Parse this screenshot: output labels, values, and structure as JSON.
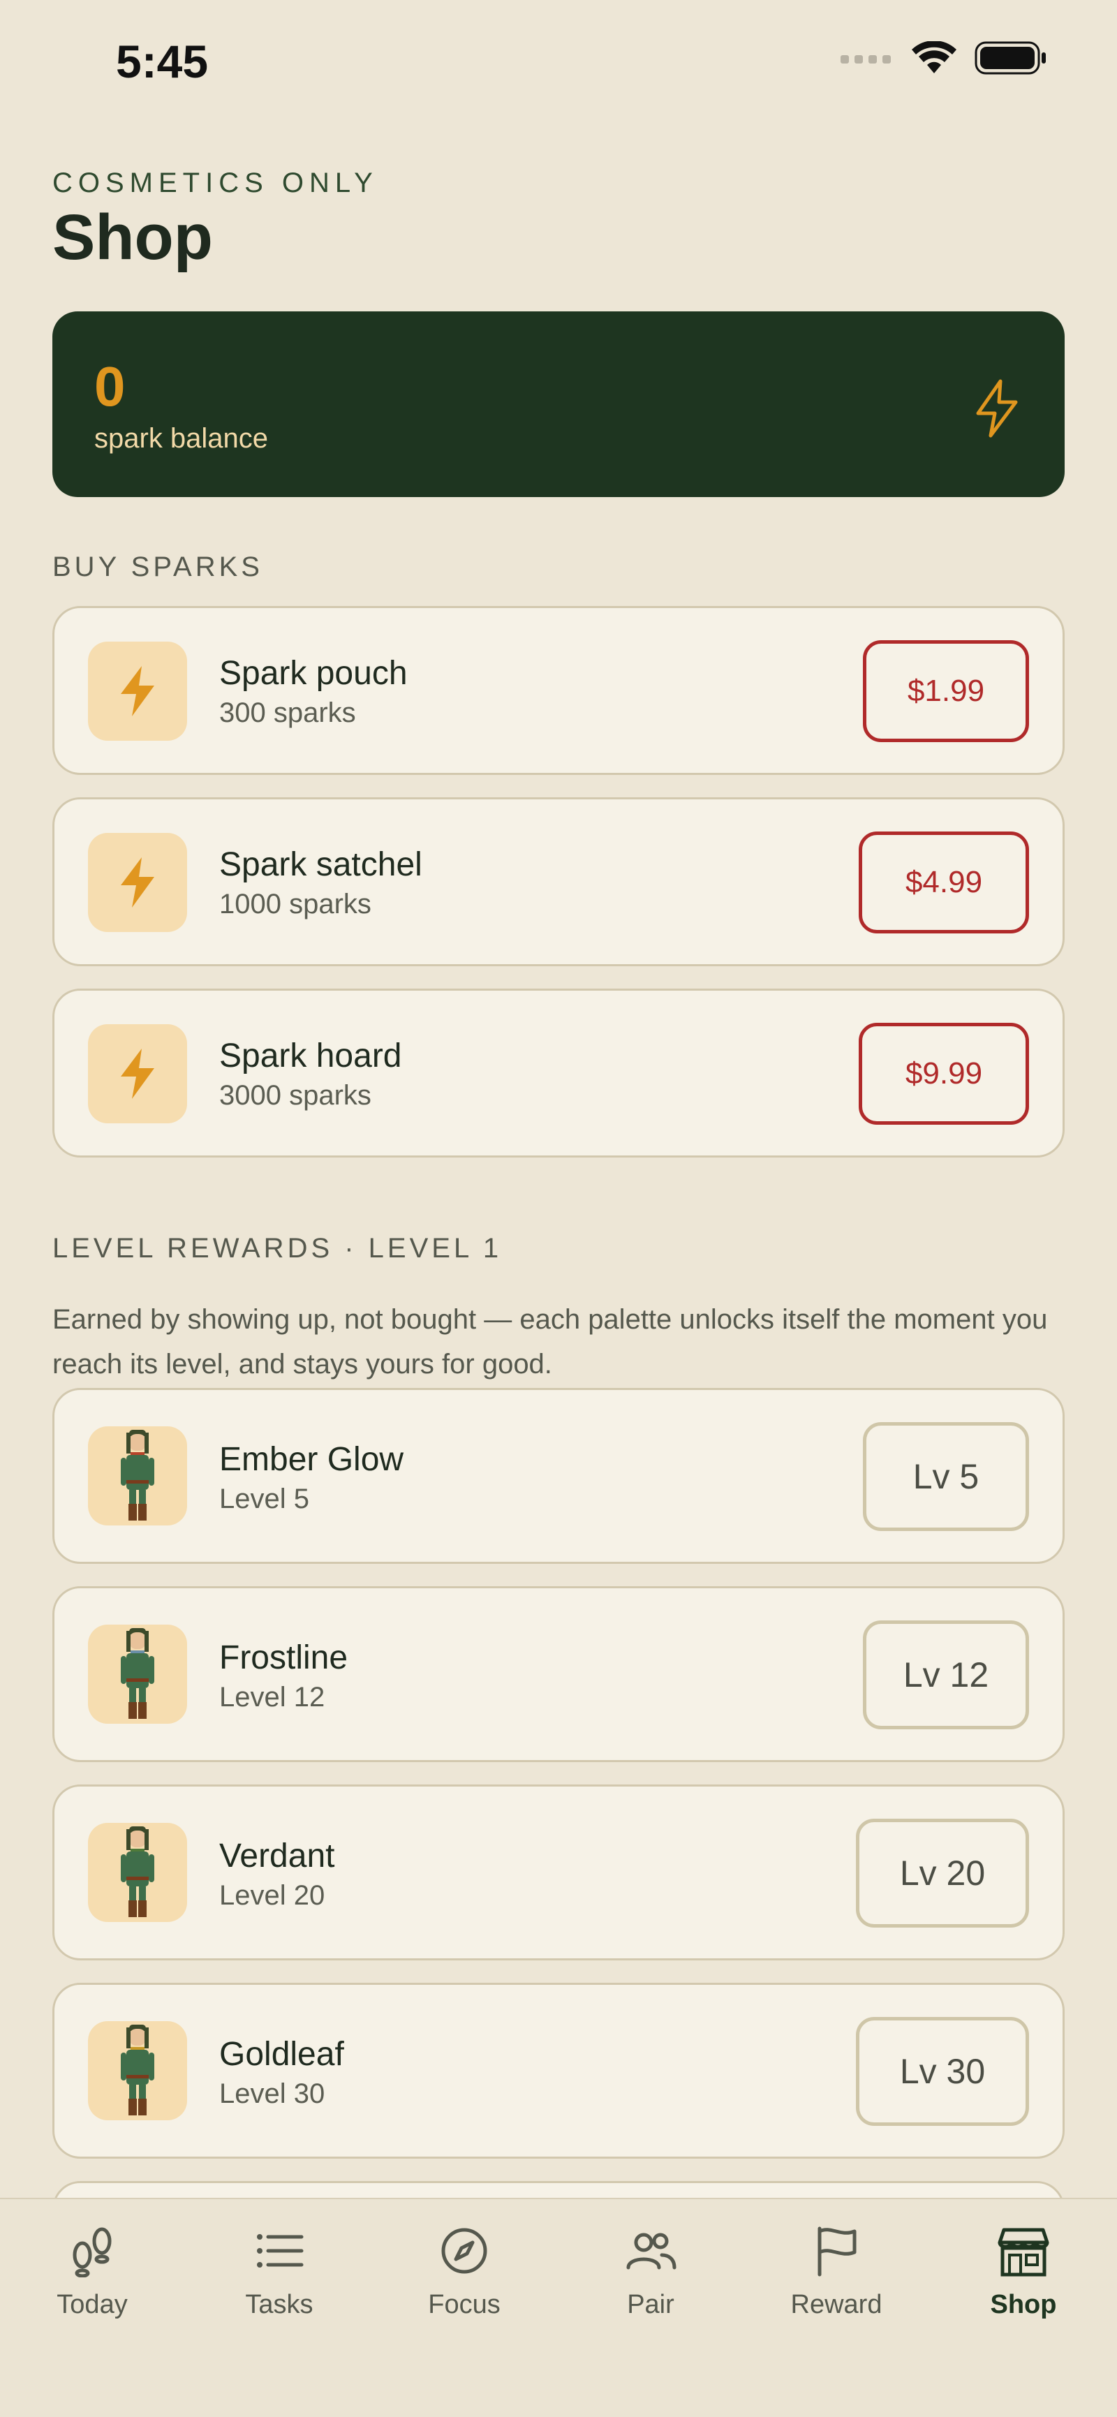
{
  "status_bar": {
    "time": "5:45"
  },
  "header": {
    "eyebrow": "COSMETICS ONLY",
    "title": "Shop"
  },
  "balance": {
    "value": "0",
    "label": "spark balance"
  },
  "buy_section": {
    "label": "BUY SPARKS",
    "items": [
      {
        "title": "Spark pouch",
        "subtitle": "300 sparks",
        "price": "$1.99"
      },
      {
        "title": "Spark satchel",
        "subtitle": "1000 sparks",
        "price": "$4.99"
      },
      {
        "title": "Spark hoard",
        "subtitle": "3000 sparks",
        "price": "$9.99"
      }
    ]
  },
  "rewards_section": {
    "label": "LEVEL REWARDS · LEVEL 1",
    "description": "Earned by showing up, not bought — each palette unlocks itself the moment you reach its level, and stays yours for good.",
    "items": [
      {
        "title": "Ember Glow",
        "subtitle": "Level 5",
        "badge": "Lv 5",
        "accent": "#b8442a"
      },
      {
        "title": "Frostline",
        "subtitle": "Level 12",
        "badge": "Lv 12",
        "accent": "#6a8fa8"
      },
      {
        "title": "Verdant",
        "subtitle": "Level 20",
        "badge": "Lv 20",
        "accent": "#4f7a3a"
      },
      {
        "title": "Goldleaf",
        "subtitle": "Level 30",
        "badge": "Lv 30",
        "accent": "#c79a2a"
      }
    ]
  },
  "tab_bar": {
    "tabs": [
      {
        "label": "Today",
        "icon": "footsteps-icon"
      },
      {
        "label": "Tasks",
        "icon": "list-icon"
      },
      {
        "label": "Focus",
        "icon": "compass-icon"
      },
      {
        "label": "Pair",
        "icon": "people-icon"
      },
      {
        "label": "Reward",
        "icon": "flag-icon"
      },
      {
        "label": "Shop",
        "icon": "storefront-icon"
      }
    ],
    "active": "Shop"
  },
  "colors": {
    "background": "#ede6d6",
    "balance_card": "#1e3520",
    "spark_accent": "#e0961f",
    "price_red": "#b02a2a"
  }
}
